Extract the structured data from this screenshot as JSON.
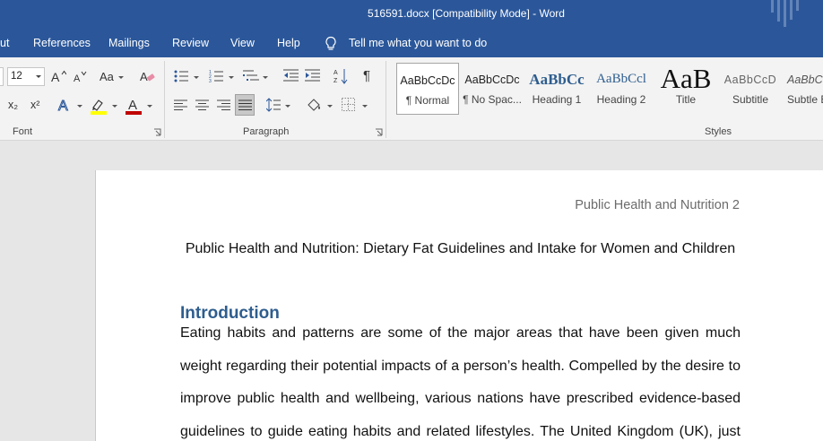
{
  "titlebar": {
    "title": "516591.docx [Compatibility Mode]  -  Word"
  },
  "tabs": {
    "layout": "ut",
    "references": "References",
    "mailings": "Mailings",
    "review": "Review",
    "view": "View",
    "help": "Help"
  },
  "tellme": {
    "text": "Tell me what you want to do"
  },
  "ribbon": {
    "font_size_value": "12",
    "change_case_label": "Aa",
    "font_group_label": "Font",
    "paragraph_group_label": "Paragraph",
    "styles_group_label": "Styles",
    "subscript_label": "x₂",
    "superscript_label": "x²",
    "font_color_label": "A",
    "text_effects_label": "A",
    "pilcrow_label": "¶",
    "highlight_color": "#ffff00",
    "font_color": "#c00000"
  },
  "styles": [
    {
      "sample": "AaBbCcDc",
      "name": "¶ Normal"
    },
    {
      "sample": "AaBbCcDc",
      "name": "¶ No Spac..."
    },
    {
      "sample": "AaBbCc",
      "name": "Heading 1"
    },
    {
      "sample": "AaBbCcl",
      "name": "Heading 2"
    },
    {
      "sample": "AaB",
      "name": "Title"
    },
    {
      "sample": "AaBbCcD",
      "name": "Subtitle"
    },
    {
      "sample": "AaBbC",
      "name": "Subtle E"
    }
  ],
  "document": {
    "header": "Public Health and Nutrition 2",
    "title": "Public Health and Nutrition: Dietary Fat Guidelines and Intake for Women and Children",
    "heading": "Introduction",
    "lines": [
      "Eating habits and patterns are some of the major areas that have been given much",
      "weight regarding their potential impacts of a person’s health. Compelled by the desire to",
      "improve public health and wellbeing, various nations have prescribed evidence-based",
      "guidelines to guide eating habits and related lifestyles. The United Kingdom (UK), just"
    ]
  },
  "colors": {
    "accent": "#2b579a",
    "heading": "#2e5d8e"
  }
}
